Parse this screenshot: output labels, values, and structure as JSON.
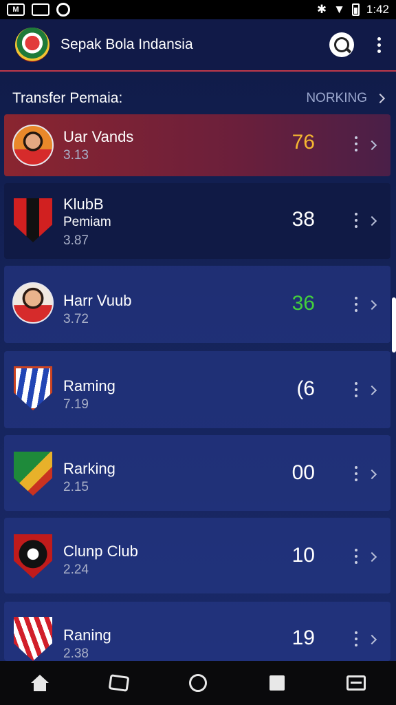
{
  "status_bar": {
    "left_icons": [
      "sim-icon",
      "image-icon",
      "circle-icon"
    ],
    "left_badge": "M",
    "time": "1:42"
  },
  "app_bar": {
    "title": "Sepak Bola Indansia",
    "logo_icon": "club-logo-icon",
    "search_icon": "search-icon",
    "more_icon": "more-vert-icon"
  },
  "section": {
    "title": "Transfer Pemaia:",
    "link_label": "NORKING"
  },
  "colors": {
    "accent": "#c0394a",
    "highlight_card": "#8a2530",
    "score_orange": "#f5b731",
    "score_green": "#43d13c"
  },
  "items": [
    {
      "name": "Uar Vands",
      "sub": "",
      "meta": "3.13",
      "score": "76",
      "score_color": "orange",
      "avatar": "player-avatar-icon",
      "highlight": true
    },
    {
      "name": "KlubB",
      "sub": "Pemiam",
      "meta": "3.87",
      "score": "38",
      "score_color": "white",
      "avatar": "club-crest-icon"
    },
    {
      "name": "Harr Vuub",
      "sub": "",
      "meta": "3.72",
      "score": "36",
      "score_color": "green",
      "avatar": "player-avatar-icon"
    },
    {
      "name": "Raming",
      "sub": "",
      "meta": "7.19",
      "score": "(6",
      "score_color": "white",
      "avatar": "club-crest-icon"
    },
    {
      "name": "Rarking",
      "sub": "",
      "meta": "2.15",
      "score": "00",
      "score_color": "white",
      "avatar": "club-crest-icon"
    },
    {
      "name": "Clunp Club",
      "sub": "",
      "meta": "2.24",
      "score": "10",
      "score_color": "white",
      "avatar": "club-crest-icon"
    },
    {
      "name": "Raning",
      "sub": "",
      "meta": "2.38",
      "score": "19",
      "score_color": "white",
      "avatar": "club-crest-icon"
    }
  ],
  "nav_bar": [
    "home-icon",
    "chat-icon",
    "circle-icon",
    "square-icon",
    "recent-apps-icon"
  ]
}
